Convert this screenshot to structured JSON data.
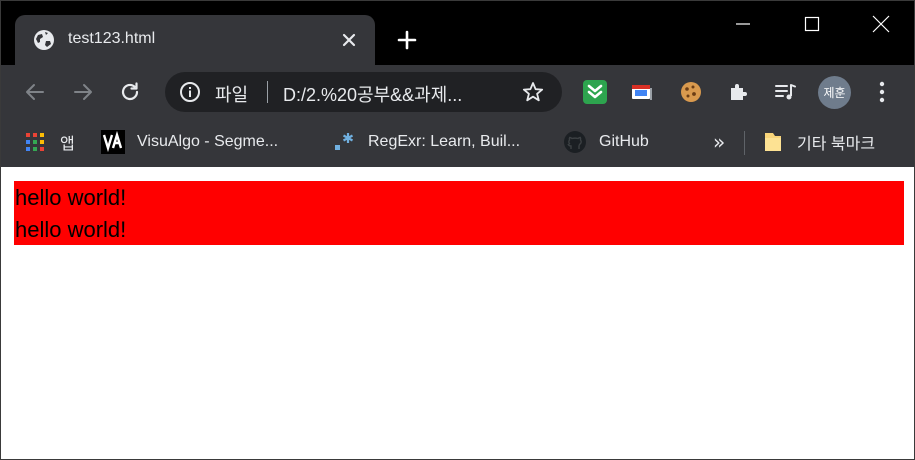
{
  "tab": {
    "title": "test123.html"
  },
  "omnibox": {
    "scheme_label": "파일",
    "url": "D:/2.%20공부&&과제..."
  },
  "bookmarks": {
    "items": [
      {
        "label": "앱",
        "icon": "apps-grid-icon"
      },
      {
        "label": "VisuAlgo - Segme...",
        "icon": "visualgo-icon"
      },
      {
        "label": "RegExr: Learn, Buil...",
        "icon": "regexr-icon"
      },
      {
        "label": "GitHub",
        "icon": "github-icon"
      }
    ],
    "overflow_label": "»",
    "other_label": "기타 북마크"
  },
  "profile": {
    "avatar_text": "제훈"
  },
  "page": {
    "lines": [
      "hello world!",
      "hello world!"
    ],
    "box_color": "#ff0000"
  },
  "colors": {
    "frame": "#000000",
    "toolbar": "#35363a",
    "omnibox": "#202124",
    "text": "#e8eaed"
  }
}
